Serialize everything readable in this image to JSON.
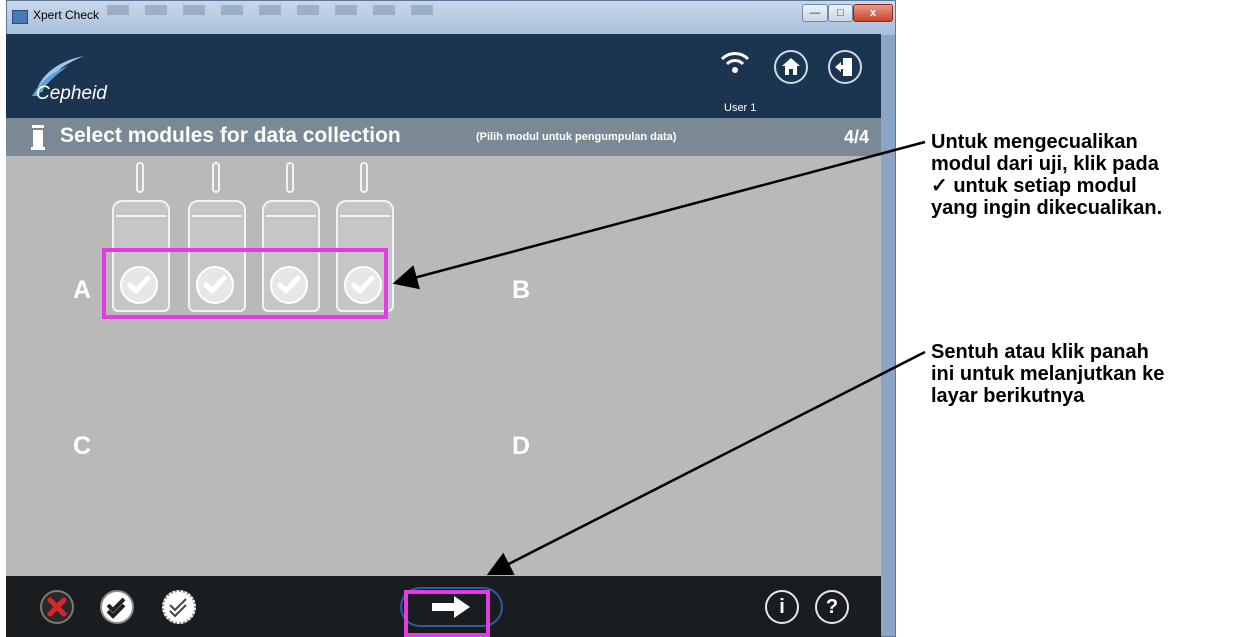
{
  "window": {
    "title": "Xpert Check",
    "controls": {
      "minimize": "—",
      "maximize": "□",
      "close": "x"
    }
  },
  "header": {
    "brand": "Cepheid",
    "user": "User 1"
  },
  "step": {
    "title": "Select modules for data collection",
    "subtitle": "(Pilih modul untuk pengumpulan data)",
    "counter": "4/4"
  },
  "quadrants": [
    "A",
    "B",
    "C",
    "D"
  ],
  "modules": {
    "group": "A",
    "count": 4,
    "all_checked": true
  },
  "toolbar": {
    "info_label": "i",
    "help_label": "?"
  },
  "annotations": {
    "callout1": "Untuk mengecualikan\nmodul dari uji, klik pada\n✓ untuk setiap modul\nyang ingin dikecualikan.",
    "callout2": "Sentuh atau klik panah\nini untuk melanjutkan ke\nlayar berikutnya",
    "highlight_color": "#e23ce2"
  },
  "colors": {
    "header_bg": "#1b3550",
    "step_bg": "#7a8993",
    "content_bg": "#b9b9b9",
    "toolbar_bg": "#1a1d20",
    "cancel_red": "#d9262c"
  }
}
